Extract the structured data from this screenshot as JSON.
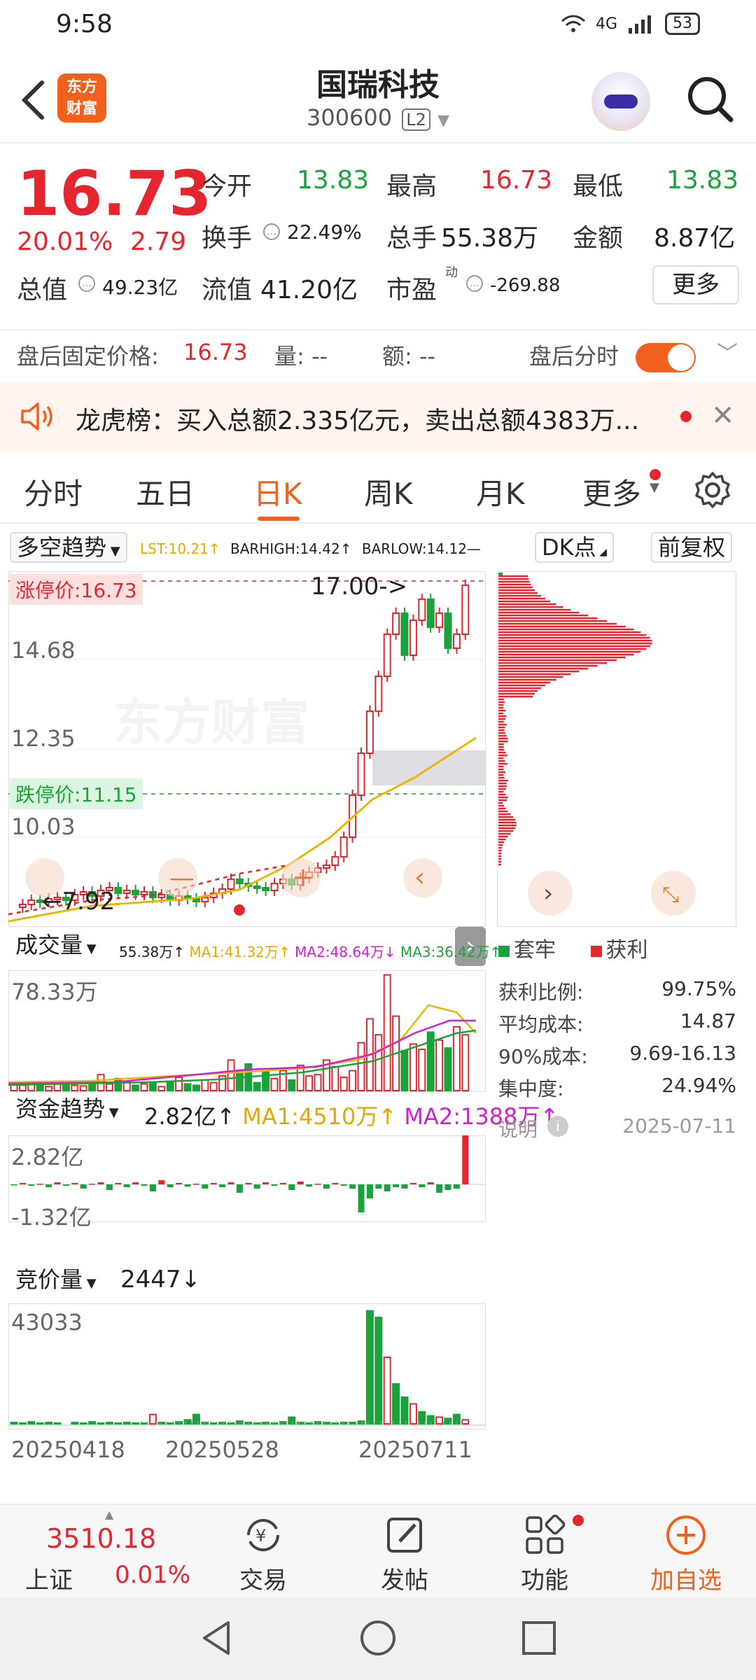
{
  "status": {
    "time": "9:58",
    "network": "4G",
    "battery": "53"
  },
  "header": {
    "logo_line1": "东方",
    "logo_line2": "财富",
    "title": "国瑞科技",
    "code": "300600",
    "level_badge": "L2"
  },
  "quote": {
    "price": "16.73",
    "pct": "20.01%",
    "change": "2.79",
    "open_label": "今开",
    "open": "13.83",
    "high_label": "最高",
    "high": "16.73",
    "low_label": "最低",
    "low": "13.83",
    "turnover_label": "换手",
    "turnover": "22.49%",
    "volume_label": "总手",
    "volume": "55.38万",
    "amount_label": "金额",
    "amount": "8.87亿",
    "mktcap_label": "总值",
    "mktcap": "49.23亿",
    "float_label": "流值",
    "float": "41.20亿",
    "pe_label": "市盈",
    "pe_sup": "动",
    "pe": "-269.88",
    "more": "更多"
  },
  "after_hours": {
    "label": "盘后固定价格:",
    "price": "16.73",
    "vol_label": "量: --",
    "amt_label": "额: --",
    "toggle_label": "盘后分时"
  },
  "banner": {
    "text": "龙虎榜：买入总额2.335亿元，卖出总额4383万..."
  },
  "tabs": [
    "分时",
    "五日",
    "日K",
    "周K",
    "月K",
    "更多"
  ],
  "chart": {
    "main_indicator": "多空趋势",
    "main_line": "LST:10.21↑",
    "barhigh": "BARHIGH:14.42↑",
    "barlow": "BARLOW:14.12—",
    "dk_button": "DK点",
    "adjust_button": "前复权",
    "limit_up_tag": "涨停价:16.73",
    "limit_down_tag": "跌停价:11.15",
    "target_tag": "17.00->",
    "low_tag": "7.92",
    "y_labels": [
      "14.68",
      "12.35",
      "10.03"
    ],
    "vol_indicator": "成交量",
    "vol_line": "55.38万↑",
    "vol_ma1": "MA1:41.32万↑",
    "vol_ma2": "MA2:48.64万↓",
    "vol_ma3": "MA3:36.42万↑",
    "vol_max": "78.33万",
    "fund_indicator": "资金趋势",
    "fund_val": "2.82亿↑",
    "fund_ma1": "MA1:4510万↑",
    "fund_ma2": "MA2:1388万↑",
    "fund_max": "2.82亿",
    "fund_min": "-1.32亿",
    "auction_indicator": "竞价量",
    "auction_val": "2447↓",
    "auction_max": "43033",
    "dates": [
      "20250418",
      "20250528",
      "20250711"
    ]
  },
  "chip": {
    "legend_trapped": "套牢",
    "legend_profit": "获利",
    "rows": [
      {
        "label": "获利比例:",
        "value": "99.75%"
      },
      {
        "label": "平均成本:",
        "value": "14.87"
      },
      {
        "label": "90%成本:",
        "value": "9.69-16.13"
      },
      {
        "label": "集中度:",
        "value": "24.94%"
      }
    ],
    "note": "说明",
    "date": "2025-07-11"
  },
  "bottom": {
    "index_value": "3510.18",
    "index_name": "上证",
    "index_pct": "0.01%",
    "items": [
      "交易",
      "发帖",
      "功能",
      "加自选"
    ]
  },
  "colors": {
    "up": "#e6262f",
    "down": "#1aa33c",
    "accent": "#f2601b"
  }
}
